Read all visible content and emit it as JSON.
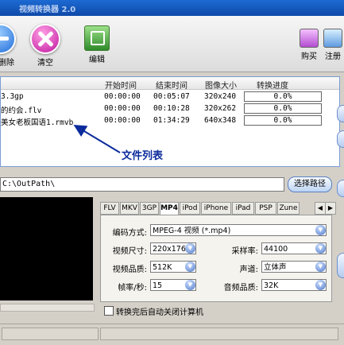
{
  "window": {
    "title": "视频转换器 2.0"
  },
  "toolbar": {
    "delete_label": "删除",
    "clear_label": "清空",
    "edit_label": "编辑",
    "buy_label": "购买",
    "register_label": "注册"
  },
  "file_list": {
    "columns": [
      "开始时间",
      "结束时间",
      "图像大小",
      "转换进度"
    ],
    "rows": [
      {
        "name": "3.3gp",
        "start": "00:00:00",
        "end": "00:05:07",
        "size": "320x240",
        "progress": "0.0%"
      },
      {
        "name": "的约会.flv",
        "start": "00:00:00",
        "end": "00:10:28",
        "size": "320x262",
        "progress": "0.0%"
      },
      {
        "name": "美女老板国语1.rmvb",
        "start": "00:00:00",
        "end": "01:34:29",
        "size": "640x348",
        "progress": "0.0%"
      }
    ],
    "annotation": "文件列表"
  },
  "output": {
    "path": "C:\\OutPath\\",
    "browse_label": "选择路径"
  },
  "tabs": [
    "FLV",
    "MKV",
    "3GP",
    "MP4",
    "iPod",
    "iPhone",
    "iPad",
    "PSP",
    "Zune"
  ],
  "tab_scroll": {
    "left": "◀",
    "right": "▶"
  },
  "settings": {
    "encode_label": "编码方式:",
    "encode_value": "MPEG-4 视频 (*.mp4)",
    "video_size_label": "视频尺寸:",
    "video_size_value": "220x176",
    "sample_rate_label": "采样率:",
    "sample_rate_value": "44100",
    "video_quality_label": "视频品质:",
    "video_quality_value": "512K",
    "channel_label": "声道:",
    "channel_value": "立体声",
    "fps_label": "帧率/秒:",
    "fps_value": "15",
    "audio_quality_label": "音频品质:",
    "audio_quality_value": "32K"
  },
  "shutdown_checkbox_label": "转换完后自动关闭计算机",
  "colors": {
    "accent": "#1f6bd9",
    "annotation": "#0b2b9c"
  }
}
